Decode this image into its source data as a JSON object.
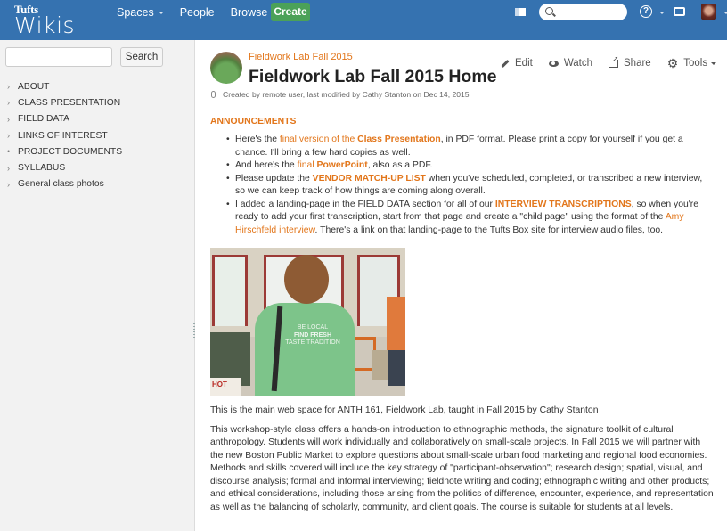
{
  "header": {
    "logo_top": "Tufts",
    "logo_bottom": "Wikis",
    "nav": [
      {
        "label": "Spaces",
        "dropdown": true
      },
      {
        "label": "People",
        "dropdown": false
      },
      {
        "label": "Browse",
        "dropdown": true
      }
    ],
    "create_label": "Create",
    "search_placeholder": "",
    "help_glyph": "?",
    "icons": [
      "sidebar-toggle-icon",
      "search-icon",
      "help-icon",
      "notifications-inbox-icon",
      "user-avatar"
    ]
  },
  "sidebar": {
    "search_value": "",
    "search_button": "Search",
    "tree": [
      {
        "label": "ABOUT",
        "bullet": "›"
      },
      {
        "label": "CLASS PRESENTATION",
        "bullet": "›"
      },
      {
        "label": "FIELD DATA",
        "bullet": "›"
      },
      {
        "label": "LINKS OF INTEREST",
        "bullet": "›"
      },
      {
        "label": "PROJECT DOCUMENTS",
        "bullet": "•"
      },
      {
        "label": "SYLLABUS",
        "bullet": "›"
      },
      {
        "label": "General class photos",
        "bullet": "›"
      }
    ]
  },
  "page": {
    "space_name": "Fieldwork Lab Fall 2015",
    "title": "Fieldwork Lab Fall 2015 Home",
    "byline": "Created by remote user, last modified by Cathy Stanton on Dec 14, 2015",
    "actions": {
      "edit": "Edit",
      "watch": "Watch",
      "share": "Share",
      "tools": "Tools"
    }
  },
  "content": {
    "announcements_heading": "ANNOUNCEMENTS",
    "announcements": [
      {
        "pre": "Here's the ",
        "link1": "final version of the ",
        "link1b": "Class Presentation",
        "post": ", in PDF format. Please print a copy for yourself if you get a chance. I'll bring a few hard copies as well."
      },
      {
        "pre": "And here's the ",
        "link1": "final ",
        "link1b": "PowerPoint",
        "post": ", also as a PDF."
      },
      {
        "pre": "Please update the ",
        "link1b": "VENDOR MATCH-UP LIST",
        "post": " when you've scheduled, completed, or transcribed a new interview, so we can keep track of how things are coming along overall."
      },
      {
        "pre": "I added a landing-page in the FIELD DATA section for all of our ",
        "link1b": "INTERVIEW TRANSCRIPTIONS",
        "mid": ", so when you're ready to add your first transcription, start from that page and create a \"child page\" using the format of the ",
        "link2": "Amy Hirschfeld interview",
        "post": ". There's a link on that landing-page to the Tufts Box site for interview audio files, too."
      }
    ],
    "photo": {
      "shirt_text_1": "BE LOCAL",
      "shirt_text_2": "FIND FRESH",
      "shirt_text_3": "TASTE TRADITION",
      "sign_text": "HOT"
    },
    "intro": "This is the main web space for ANTH 161, Fieldwork Lab, taught in Fall 2015 by Cathy Stanton",
    "description": "This workshop-style class offers a hands-on introduction to ethnographic methods, the signature toolkit of cultural anthropology. Students will work individually and collaboratively on small-scale projects. In Fall 2015 we will partner with the new Boston Public Market to explore questions about small-scale urban food marketing and regional food economies. Methods and skills covered will include the key strategy of \"participant-observation\"; research design; spatial, visual, and discourse analysis; formal and informal interviewing; fieldnote writing and coding; ethnographic writing and other products; and ethical considerations, including those arising from the politics of difference, encounter, experience, and representation as well as the balancing of scholarly, community, and client goals. The course is suitable for students at all levels."
  },
  "colors": {
    "header_bg": "#3572b0",
    "create_green": "#4ba158",
    "link_orange": "#e2761b",
    "sidebar_bg": "#f2f2f2"
  }
}
